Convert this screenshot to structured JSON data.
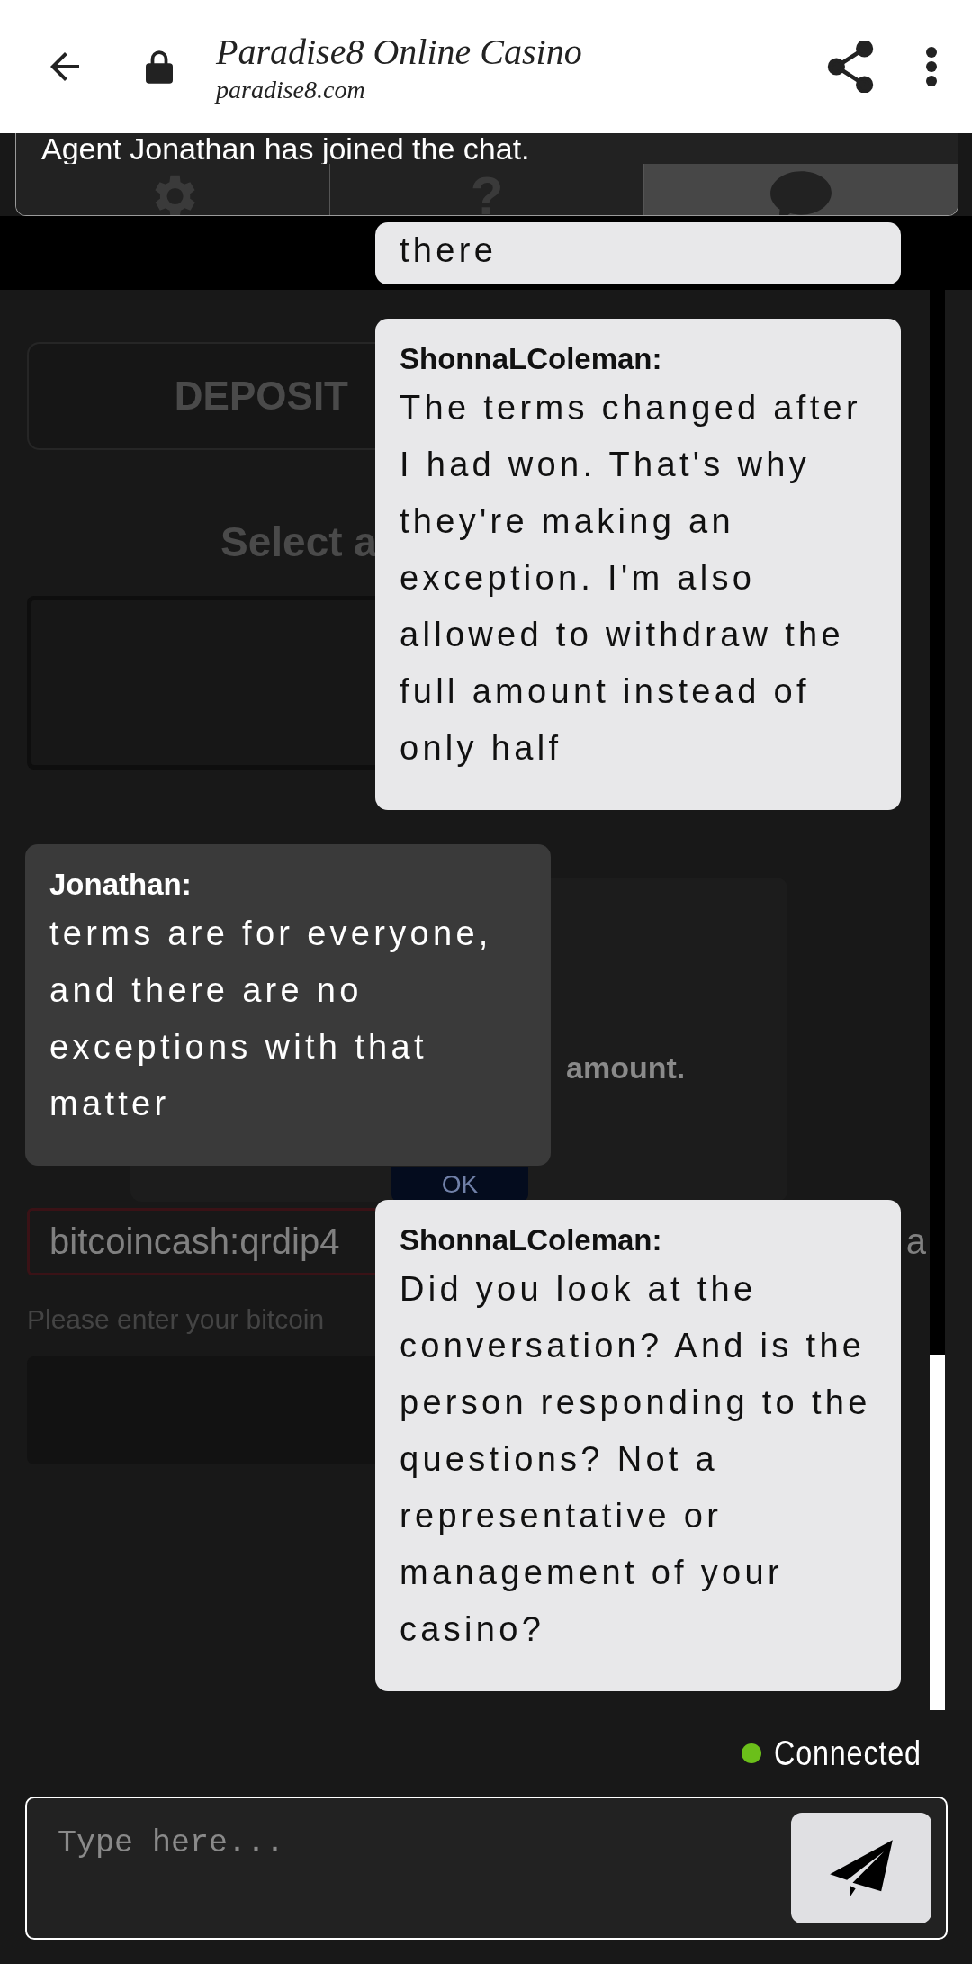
{
  "browser_bar": {
    "title": "Paradise8 Online Casino",
    "url": "paradise8.com"
  },
  "chat_header": {
    "notice": "Agent Jonathan has joined the chat.",
    "tabs": [
      {
        "kind": "settings",
        "selected": false
      },
      {
        "kind": "help",
        "label": "?",
        "selected": false
      },
      {
        "kind": "chat",
        "selected": true
      }
    ]
  },
  "background_page": {
    "tab": "DEPOSIT",
    "heading": "Select a",
    "dialog": {
      "message": "amount.",
      "button": "OK"
    },
    "address_field": {
      "value": "bitcoincash:qrdip4",
      "value_end": "a"
    },
    "hint": "Please enter your bitcoin"
  },
  "messages": [
    {
      "kind": "user",
      "text": "there"
    },
    {
      "kind": "user",
      "sender": "ShonnaLColeman:",
      "text": "The terms changed after I had won. That's why they're making an exception. I'm also allowed to withdraw the full amount instead of only half"
    },
    {
      "kind": "agent",
      "sender": "Jonathan:",
      "text": "terms are for everyone, and there are no exceptions with that matter"
    },
    {
      "kind": "user",
      "sender": "ShonnaLColeman:",
      "text": "Did you look at the conversation? And is the person responding to the questions? Not a representative or management of your casino?"
    }
  ],
  "status": {
    "label": "Connected",
    "online": true
  },
  "composer": {
    "placeholder": "Type here..."
  }
}
